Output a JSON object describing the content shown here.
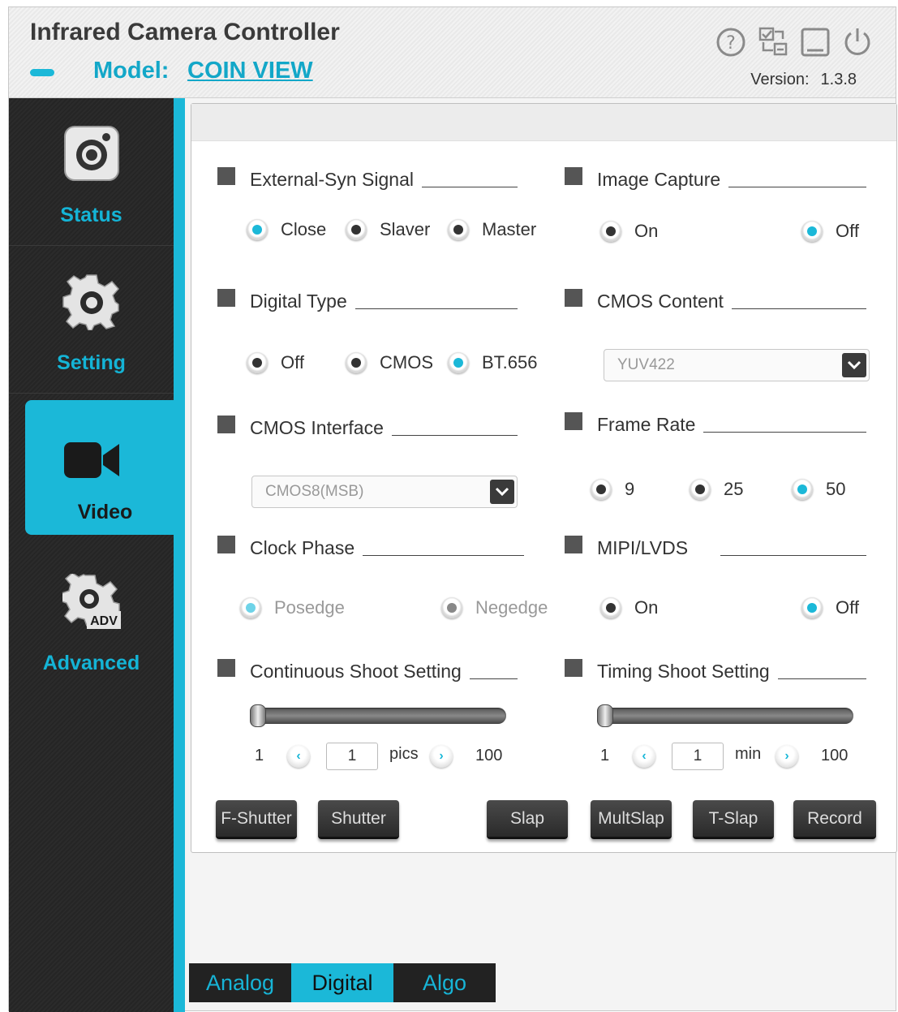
{
  "app": {
    "title": "Infrared Camera Controller",
    "model_label": "Model:",
    "model_value": "COIN VIEW",
    "version_label": "Version:",
    "version_value": "1.3.8",
    "header_icons": [
      "help-icon",
      "checklist-icon",
      "minimize-icon",
      "power-icon"
    ]
  },
  "sidebar": {
    "items": [
      {
        "label": "Status",
        "icon": "camera-icon"
      },
      {
        "label": "Setting",
        "icon": "gear-icon"
      },
      {
        "label": "Video",
        "icon": "video-camera-icon",
        "active": true
      },
      {
        "label": "Advanced",
        "icon": "gear-adv-icon",
        "badge": "ADV"
      }
    ]
  },
  "bottom_tabs": [
    {
      "label": "Analog"
    },
    {
      "label": "Digital",
      "active": true
    },
    {
      "label": "Algo"
    }
  ],
  "panel": {
    "external_syn": {
      "title": "External-Syn Signal",
      "options": [
        "Close",
        "Slaver",
        "Master"
      ],
      "selected": "Close"
    },
    "image_capture": {
      "title": "Image Capture",
      "options": [
        "On",
        "Off"
      ],
      "selected": "Off"
    },
    "digital_type": {
      "title": "Digital Type",
      "options": [
        "Off",
        "CMOS",
        "BT.656"
      ],
      "selected": "BT.656"
    },
    "cmos_content": {
      "title": "CMOS Content",
      "value": "YUV422"
    },
    "cmos_interface": {
      "title": "CMOS Interface",
      "value": "CMOS8(MSB)"
    },
    "frame_rate": {
      "title": "Frame Rate",
      "options": [
        "9",
        "25",
        "50"
      ],
      "selected": "50"
    },
    "clock_phase": {
      "title": "Clock Phase",
      "options": [
        "Posedge",
        "Negedge"
      ],
      "selected": "Posedge"
    },
    "mipi_lvds": {
      "title": "MIPI/LVDS",
      "options": [
        "On",
        "Off"
      ],
      "selected": "Off"
    },
    "continuous_shoot": {
      "title": "Continuous Shoot Setting",
      "min": "1",
      "max": "100",
      "value": "1",
      "unit": "pics",
      "level": 0
    },
    "timing_shoot": {
      "title": "Timing Shoot Setting",
      "min": "1",
      "max": "100",
      "value": "1",
      "unit": "min",
      "level": 0
    },
    "buttons": [
      "F-Shutter",
      "Shutter",
      "Slap",
      "MultSlap",
      "T-Slap",
      "Record"
    ]
  },
  "colors": {
    "accent": "#1bb8d8",
    "sidebar_bg": "#2b2b2b",
    "button_bg": "#333333"
  }
}
